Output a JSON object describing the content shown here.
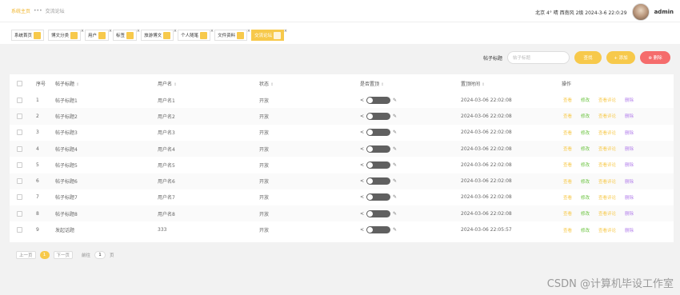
{
  "breadcrumb": {
    "home": "系统主页",
    "sep": "•••",
    "current": "交流论坛"
  },
  "header": {
    "weather": "北京  4°  晴  西南风  2级  2024-3-6 22:0:29",
    "username": "admin"
  },
  "tabs": [
    {
      "label": "系统首页",
      "close": ""
    },
    {
      "label": "博文分类",
      "close": "×"
    },
    {
      "label": "用户",
      "close": "×"
    },
    {
      "label": "标签",
      "close": "×"
    },
    {
      "label": "旅游博文",
      "close": "×"
    },
    {
      "label": "个人随笔",
      "close": "×"
    },
    {
      "label": "文件资料",
      "close": "×"
    },
    {
      "label": "交流论坛",
      "close": "×",
      "active": true
    }
  ],
  "toolbar": {
    "label": "帖子标题",
    "placeholder": "帖子标题",
    "search": "查找",
    "add": "+ 添加",
    "delete": "⊗ 删除"
  },
  "columns": {
    "index": "序号",
    "title": "帖子标题",
    "user": "用户名",
    "status": "状态",
    "pinned": "是否置顶",
    "time": "置顶时间",
    "ops": "操作"
  },
  "ops": {
    "view": "查看",
    "edit": "修改",
    "comments": "查看评论",
    "delete": "删除"
  },
  "rows": [
    {
      "idx": "1",
      "title": "帖子标题1",
      "user": "用户名1",
      "status": "开放",
      "time": "2024-03-06 22:02:08"
    },
    {
      "idx": "2",
      "title": "帖子标题2",
      "user": "用户名2",
      "status": "开放",
      "time": "2024-03-06 22:02:08"
    },
    {
      "idx": "3",
      "title": "帖子标题3",
      "user": "用户名3",
      "status": "开放",
      "time": "2024-03-06 22:02:08"
    },
    {
      "idx": "4",
      "title": "帖子标题4",
      "user": "用户名4",
      "status": "开放",
      "time": "2024-03-06 22:02:08"
    },
    {
      "idx": "5",
      "title": "帖子标题5",
      "user": "用户名5",
      "status": "开放",
      "time": "2024-03-06 22:02:08"
    },
    {
      "idx": "6",
      "title": "帖子标题6",
      "user": "用户名6",
      "status": "开放",
      "time": "2024-03-06 22:02:08"
    },
    {
      "idx": "7",
      "title": "帖子标题7",
      "user": "用户名7",
      "status": "开放",
      "time": "2024-03-06 22:02:08"
    },
    {
      "idx": "8",
      "title": "帖子标题8",
      "user": "用户名8",
      "status": "开放",
      "time": "2024-03-06 22:02:08"
    },
    {
      "idx": "9",
      "title": "发起话题",
      "user": "333",
      "status": "开放",
      "time": "2024-03-06 22:05:57"
    }
  ],
  "pager": {
    "prev": "上一页",
    "current": "1",
    "next": "下一页",
    "goto": "前往",
    "page": "1",
    "unit": "页"
  },
  "watermark": "CSDN @计算机毕设工作室",
  "colors": {
    "accent": "#f7c94b",
    "danger": "#f56c6c",
    "success": "#67c23a",
    "purple": "#b37feb"
  }
}
